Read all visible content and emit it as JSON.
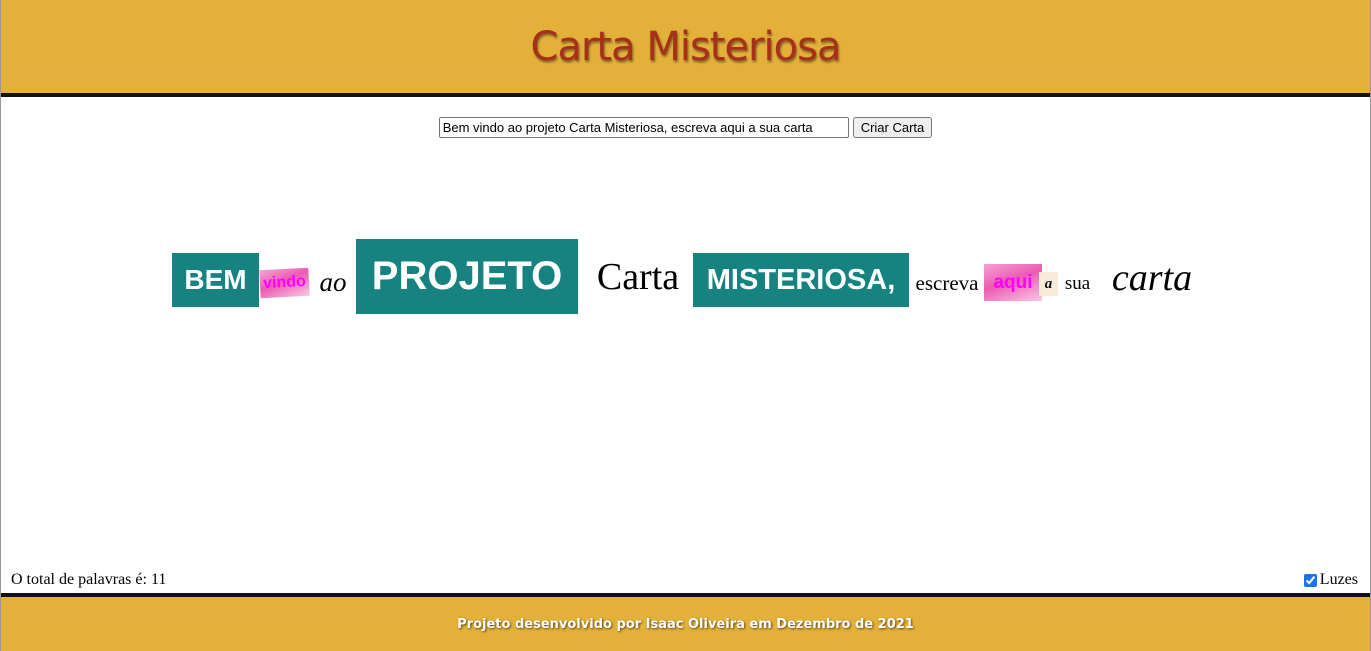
{
  "header": {
    "title": "Carta Misteriosa"
  },
  "controls": {
    "input_value": "Bem vindo ao projeto Carta Misteriosa, escreva aqui a sua carta",
    "create_button": "Criar Carta"
  },
  "letter": {
    "words": [
      {
        "text": "BEM",
        "style": "teal"
      },
      {
        "text": "vindo",
        "style": "pink"
      },
      {
        "text": "ao",
        "style": "plain-italic"
      },
      {
        "text": "PROJETO",
        "style": "teal"
      },
      {
        "text": "Carta",
        "style": "plain"
      },
      {
        "text": "MISTERIOSA,",
        "style": "teal"
      },
      {
        "text": "escreva",
        "style": "plain"
      },
      {
        "text": "aqui",
        "style": "pink"
      },
      {
        "text": "a",
        "style": "paper"
      },
      {
        "text": "sua",
        "style": "plain"
      },
      {
        "text": "carta",
        "style": "plain-italic"
      }
    ]
  },
  "status": {
    "word_count_label": "O total de palavras é: 11",
    "lights_label": "Luzes",
    "lights_checked": true
  },
  "footer": {
    "text": "Projeto desenvolvido por Isaac Oliveira em Dezembro de 2021"
  },
  "colors": {
    "header_bg": "#e3b03a",
    "title": "#a8301a",
    "teal": "#168380",
    "pink_text": "#ff00ff"
  }
}
